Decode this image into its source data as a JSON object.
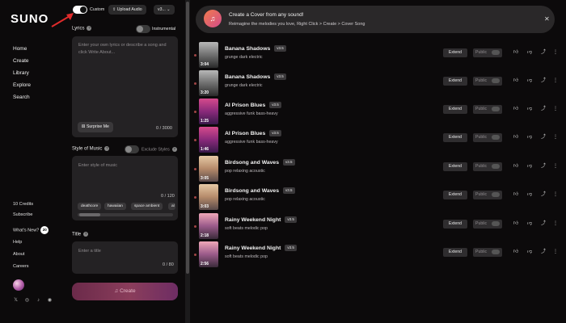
{
  "nav": {
    "logo": "SUNO",
    "items": [
      "Home",
      "Create",
      "Library",
      "Explore",
      "Search"
    ],
    "credits": "10 Credits",
    "subscribe": "Subscribe",
    "whats_new": "What's New?",
    "whats_new_count": "20",
    "help": "Help",
    "about": "About",
    "careers": "Careers"
  },
  "create": {
    "custom_label": "Custom",
    "upload_label": "Upload Audio",
    "version": "v3...",
    "lyrics_label": "Lyrics",
    "instrumental_label": "Instrumental",
    "lyrics_placeholder": "Enter your own lyrics or describe a song and click Write About...",
    "surprise_label": "Surprise Me",
    "lyrics_counter": "0 / 3000",
    "style_label": "Style of Music",
    "exclude_label": "Exclude Styles",
    "style_placeholder": "Enter style of music",
    "style_counter": "0 / 120",
    "style_chips": [
      "deathcore",
      "hawaiian",
      "space ambient",
      "al"
    ],
    "title_label": "Title",
    "title_placeholder": "Enter a title",
    "title_counter": "0 / 80",
    "create_button": "Create"
  },
  "banner": {
    "title": "Create a Cover from any sound!",
    "subtitle": "Reimagine the melodies you love, Right Click > Create > Cover Song"
  },
  "songs": [
    {
      "title": "Banana Shadows",
      "version": "v3.5",
      "tags": "grunge dark electric",
      "duration": "3:04",
      "thumb": "t-bw"
    },
    {
      "title": "Banana Shadows",
      "version": "v3.5",
      "tags": "grunge dark electric",
      "duration": "3:20",
      "thumb": "t-bw"
    },
    {
      "title": "AI Prison Blues",
      "version": "v3.5",
      "tags": "aggressive funk bass-heavy",
      "duration": "1:25",
      "thumb": "t-pink"
    },
    {
      "title": "AI Prison Blues",
      "version": "v3.5",
      "tags": "aggressive funk bass-heavy",
      "duration": "1:46",
      "thumb": "t-pink"
    },
    {
      "title": "Birdsong and Waves",
      "version": "v3.5",
      "tags": "pop relaxing acoustic",
      "duration": "3:05",
      "thumb": "t-sand"
    },
    {
      "title": "Birdsong and Waves",
      "version": "v3.5",
      "tags": "pop relaxing acoustic",
      "duration": "3:03",
      "thumb": "t-sand"
    },
    {
      "title": "Rainy Weekend Night",
      "version": "v3.5",
      "tags": "soft beats melodic pop",
      "duration": "2:18",
      "thumb": "t-dusk"
    },
    {
      "title": "Rainy Weekend Night",
      "version": "v3.5",
      "tags": "soft beats melodic pop",
      "duration": "2:56",
      "thumb": "t-dusk"
    }
  ],
  "song_actions": {
    "extend": "Extend",
    "public": "Public"
  },
  "colors": {
    "accent": "#d34d8a",
    "arrow": "#e02b2b",
    "background": "#0c0a0b"
  }
}
